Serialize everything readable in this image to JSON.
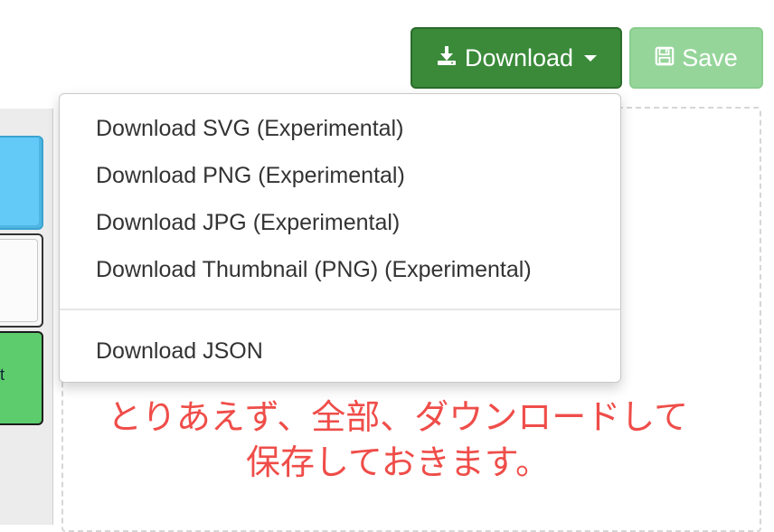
{
  "toolbar": {
    "download_label": "Download",
    "download_icon": "download-icon",
    "save_label": "Save",
    "save_icon": "floppy-disk-icon"
  },
  "menu": {
    "items": [
      {
        "label": "Download SVG (Experimental)"
      },
      {
        "label": "Download PNG (Experimental)"
      },
      {
        "label": "Download JPG (Experimental)"
      },
      {
        "label": "Download Thumbnail (PNG) (Experimental)"
      },
      {
        "label": "Download JSON"
      }
    ]
  },
  "palette": {
    "green_block_text": "t"
  },
  "note": {
    "line1": "とりあえず、全部、ダウンロードして",
    "line2": "保存しておきます。"
  },
  "colors": {
    "download_button": "#3a8a3a",
    "save_button": "#96d59a",
    "note_text": "#ef4d49"
  }
}
